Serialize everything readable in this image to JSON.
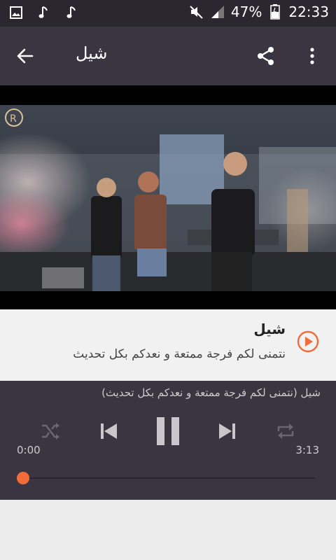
{
  "status": {
    "battery": "47%",
    "time": "22:33"
  },
  "appbar": {
    "title": "شيل"
  },
  "info": {
    "title": "شيل",
    "subtitle": "نتمنى لكم فرجة ممتعة و نعدكم بكل تحديث"
  },
  "player": {
    "now_playing": "شيل (نتمنى لكم فرجة ممتعة و نعدكم بكل تحديث)",
    "elapsed": "0:00",
    "duration": "3:13",
    "progress": 0.0
  },
  "colors": {
    "accent": "#f26b3a",
    "bar": "#3a3540",
    "status": "#2b2730"
  },
  "icons": [
    "image-icon",
    "music-note-icon",
    "mute-icon",
    "signal-icon",
    "battery-icon",
    "back-arrow-icon",
    "share-icon",
    "more-vert-icon",
    "play-circle-icon",
    "shuffle-icon",
    "previous-icon",
    "pause-icon",
    "next-icon",
    "repeat-icon"
  ]
}
